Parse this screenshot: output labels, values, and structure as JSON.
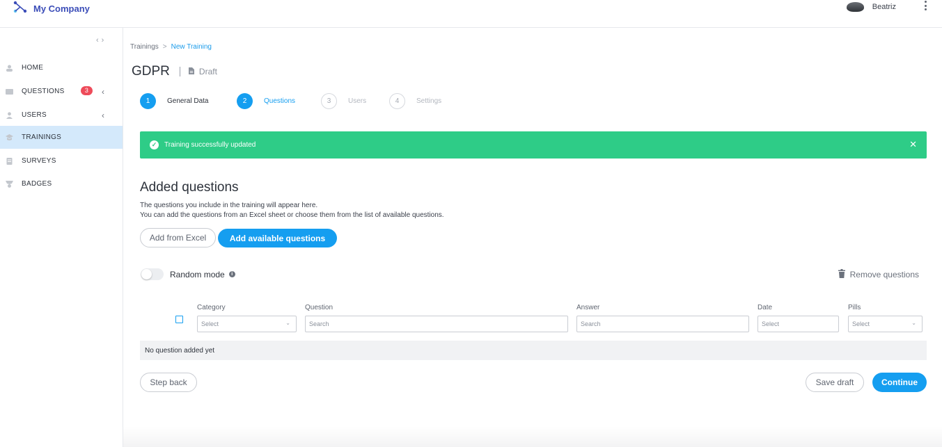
{
  "header": {
    "brand_name": "My Company",
    "user_name": "Beatriz"
  },
  "sidebar": {
    "items": [
      {
        "label": "HOME",
        "icon": "home-icon"
      },
      {
        "label": "QUESTIONS",
        "icon": "questions-icon",
        "badge": "3"
      },
      {
        "label": "USERS",
        "icon": "user-icon"
      },
      {
        "label": "TRAININGS",
        "icon": "trainings-icon",
        "active": true
      },
      {
        "label": "SURVEYS",
        "icon": "surveys-icon"
      },
      {
        "label": "BADGES",
        "icon": "badges-icon"
      }
    ]
  },
  "breadcrumb": {
    "parent": "Trainings",
    "separator": ">",
    "current": "New Training"
  },
  "page": {
    "title": "GDPR",
    "status": "Draft"
  },
  "steps": [
    {
      "number": "1",
      "label": "General Data",
      "state": "done"
    },
    {
      "number": "2",
      "label": "Questions",
      "state": "current"
    },
    {
      "number": "3",
      "label": "Users",
      "state": "upcoming"
    },
    {
      "number": "4",
      "label": "Settings",
      "state": "upcoming"
    }
  ],
  "alert": {
    "message": "Training successfully updated",
    "color": "#2ecc87"
  },
  "questions_section": {
    "heading": "Added questions",
    "description_line1": "The questions you include in the training will appear here.",
    "description_line2": "You can add the questions from an Excel sheet or choose them from the list of available questions.",
    "add_excel_label": "Add from Excel",
    "add_available_label": "Add available questions",
    "random_mode_label": "Random mode",
    "random_mode_on": false,
    "remove_label": "Remove questions"
  },
  "table": {
    "columns": [
      {
        "header": "Category",
        "placeholder": "Select"
      },
      {
        "header": "Question",
        "placeholder": "Search"
      },
      {
        "header": "Answer",
        "placeholder": "Search"
      },
      {
        "header": "Date",
        "placeholder": "Select"
      },
      {
        "header": "Pills",
        "placeholder": "Select"
      }
    ],
    "empty_message": "No question added yet"
  },
  "footer": {
    "step_back_label": "Step back",
    "save_draft_label": "Save draft",
    "continue_label": "Continue"
  },
  "colors": {
    "primary": "#159ef0",
    "success": "#2ecc87",
    "badge": "#ee4b5a",
    "active_nav": "#d4e9fb"
  }
}
